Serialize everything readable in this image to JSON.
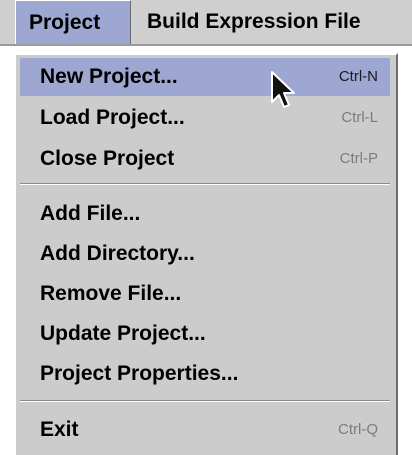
{
  "menubar": {
    "items": [
      {
        "label": "Project"
      },
      {
        "label": "Build Expression File"
      }
    ]
  },
  "menu": {
    "group1": [
      {
        "label": "New Project...",
        "shortcut": "Ctrl-N"
      },
      {
        "label": "Load Project...",
        "shortcut": "Ctrl-L"
      },
      {
        "label": "Close Project",
        "shortcut": "Ctrl-P"
      }
    ],
    "group2": [
      {
        "label": "Add File..."
      },
      {
        "label": "Add Directory..."
      },
      {
        "label": "Remove File..."
      },
      {
        "label": "Update Project..."
      },
      {
        "label": "Project Properties..."
      }
    ],
    "group3": [
      {
        "label": "Exit",
        "shortcut": "Ctrl-Q"
      }
    ]
  },
  "colors": {
    "highlight": "#9ea7d1",
    "menu_bg": "#cccccc",
    "shortcut_text": "#7c7c7c"
  },
  "icons": [
    "mouse-pointer-icon"
  ]
}
